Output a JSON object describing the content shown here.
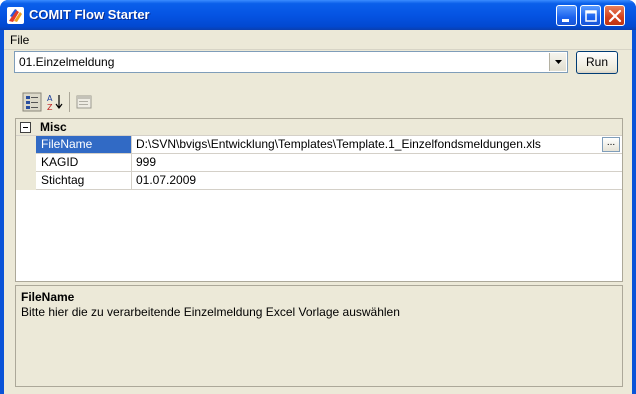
{
  "window": {
    "title": "COMIT Flow Starter",
    "accent_color": "#0554e3",
    "icon": "comit-app-icon"
  },
  "titlebar_buttons": {
    "minimize_icon": "minimize-icon",
    "maximize_icon": "maximize-icon",
    "close_icon": "close-icon"
  },
  "menu": {
    "items": [
      {
        "label": "File"
      }
    ]
  },
  "flow_selector": {
    "selected_value": "01.Einzelmeldung",
    "run_label": "Run"
  },
  "property_toolbar": {
    "buttons": [
      {
        "icon": "categorized-view-icon"
      },
      {
        "icon": "sort-alphabetical-icon"
      },
      {
        "icon": "property-pages-icon"
      }
    ]
  },
  "property_grid": {
    "category": "Misc",
    "rows": [
      {
        "name": "FileName",
        "value": "D:\\SVN\\bvigs\\Entwicklung\\Templates\\Template.1_Einzelfondsmeldungen.xls",
        "selected": true,
        "has_browse_button": true,
        "browse_label": "..."
      },
      {
        "name": "KAGID",
        "value": "999",
        "selected": false
      },
      {
        "name": "Stichtag",
        "value": "01.07.2009",
        "selected": false
      }
    ]
  },
  "description": {
    "title": "FileName",
    "text": "Bitte hier die zu verarbeitende Einzelmeldung Excel Vorlage auswählen"
  }
}
